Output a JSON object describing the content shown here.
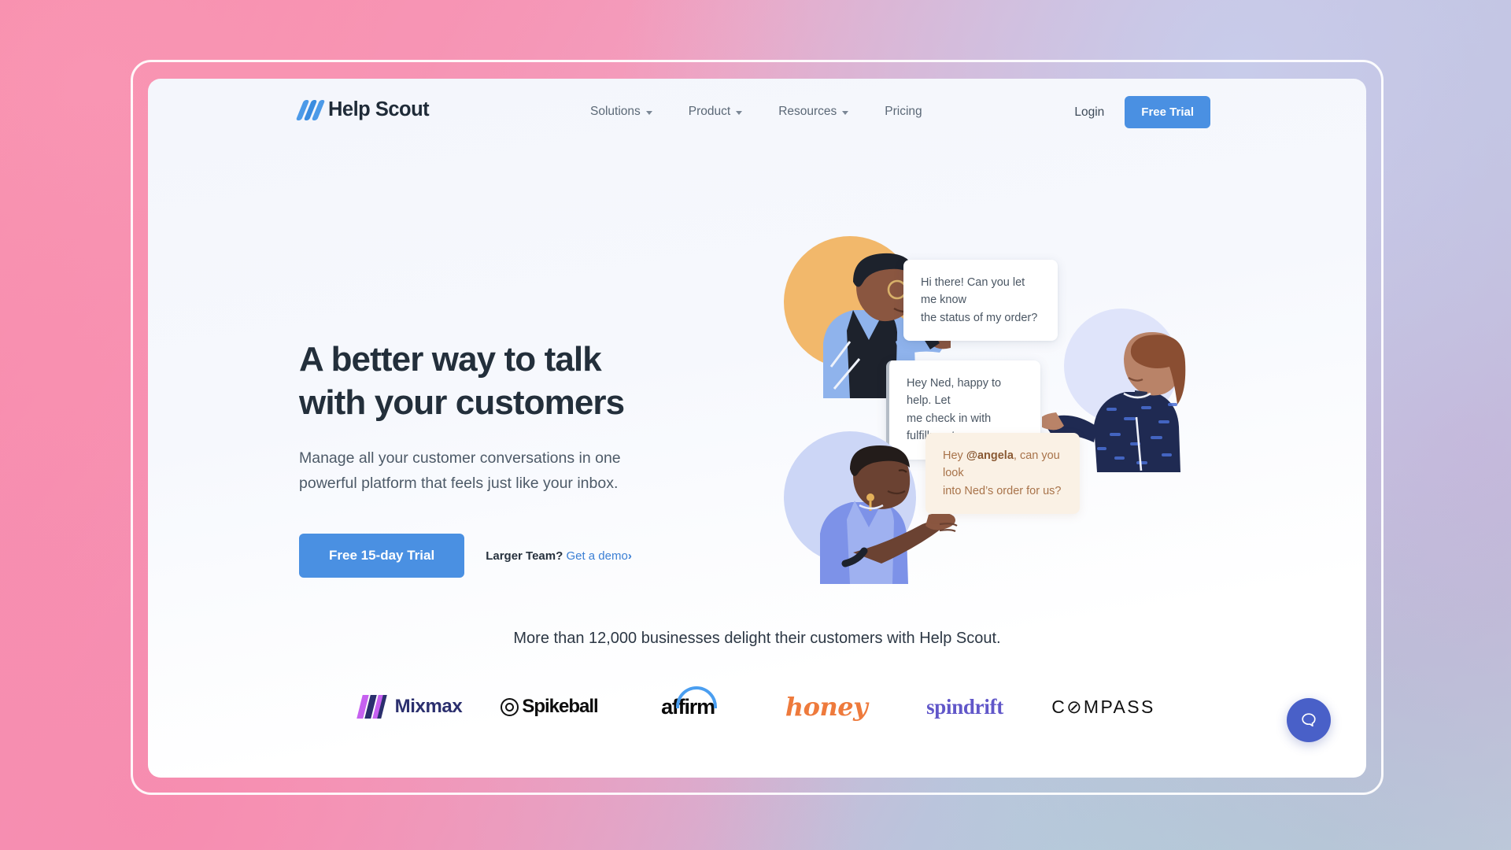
{
  "brand": {
    "name": "Help Scout",
    "logo_icon": "help-scout-slashes-icon",
    "accent_blue": "#4a90e2",
    "headline_color": "#232f3b",
    "chat_widget_color": "#4960c8"
  },
  "nav": {
    "links": [
      {
        "label": "Solutions",
        "has_dropdown": true
      },
      {
        "label": "Product",
        "has_dropdown": true
      },
      {
        "label": "Resources",
        "has_dropdown": true
      },
      {
        "label": "Pricing",
        "has_dropdown": false
      }
    ],
    "login_label": "Login",
    "cta_label": "Free Trial"
  },
  "hero": {
    "headline_line1": "A better way to talk",
    "headline_line2": "with your customers",
    "subhead_line1": "Manage all your customer conversations in one",
    "subhead_line2": "powerful platform that feels just like your inbox.",
    "primary_cta": "Free 15-day Trial",
    "secondary_prefix": "Larger Team?",
    "secondary_link": "Get a demo",
    "secondary_chevron": "›"
  },
  "illustration": {
    "figures": [
      {
        "name": "customer-ned-avatar",
        "circle_color": "#f2b86b"
      },
      {
        "name": "support-agent-avatar",
        "circle_color": "#dfe4fa"
      },
      {
        "name": "teammate-angela-avatar",
        "circle_color": "#ccd6f6"
      }
    ],
    "bubbles": [
      {
        "name": "customer-message-bubble",
        "style": "plain",
        "line1": "Hi there! Can you let me know",
        "line2": "the status of my order?"
      },
      {
        "name": "agent-reply-bubble",
        "style": "accent-left-border",
        "line1": "Hey Ned, happy to help. Let",
        "line2": "me check in with fulfillment."
      },
      {
        "name": "internal-note-bubble",
        "style": "note",
        "prefix": "Hey ",
        "mention": "@angela",
        "line1_rest": ", can you look",
        "line2": "into Ned’s order for us?"
      }
    ]
  },
  "social_proof": {
    "headline": "More than 12,000 businesses delight their customers with Help Scout.",
    "logos": [
      {
        "name": "mixmax-logo",
        "label": "Mixmax",
        "color": "#2b2f6e"
      },
      {
        "name": "spikeball-logo",
        "label": "Spikeball",
        "color": "#0d0d0d"
      },
      {
        "name": "affirm-logo",
        "label": "affirm",
        "color": "#0a0a0a"
      },
      {
        "name": "honey-logo",
        "label": "honey",
        "color": "#ee7a3c"
      },
      {
        "name": "spindrift-logo",
        "label": "spindrift",
        "color": "#6157c9"
      },
      {
        "name": "compass-logo",
        "label": "C⊘MPASS",
        "color": "#101010"
      }
    ]
  },
  "chat_widget": {
    "icon": "speech-bubble-icon"
  }
}
